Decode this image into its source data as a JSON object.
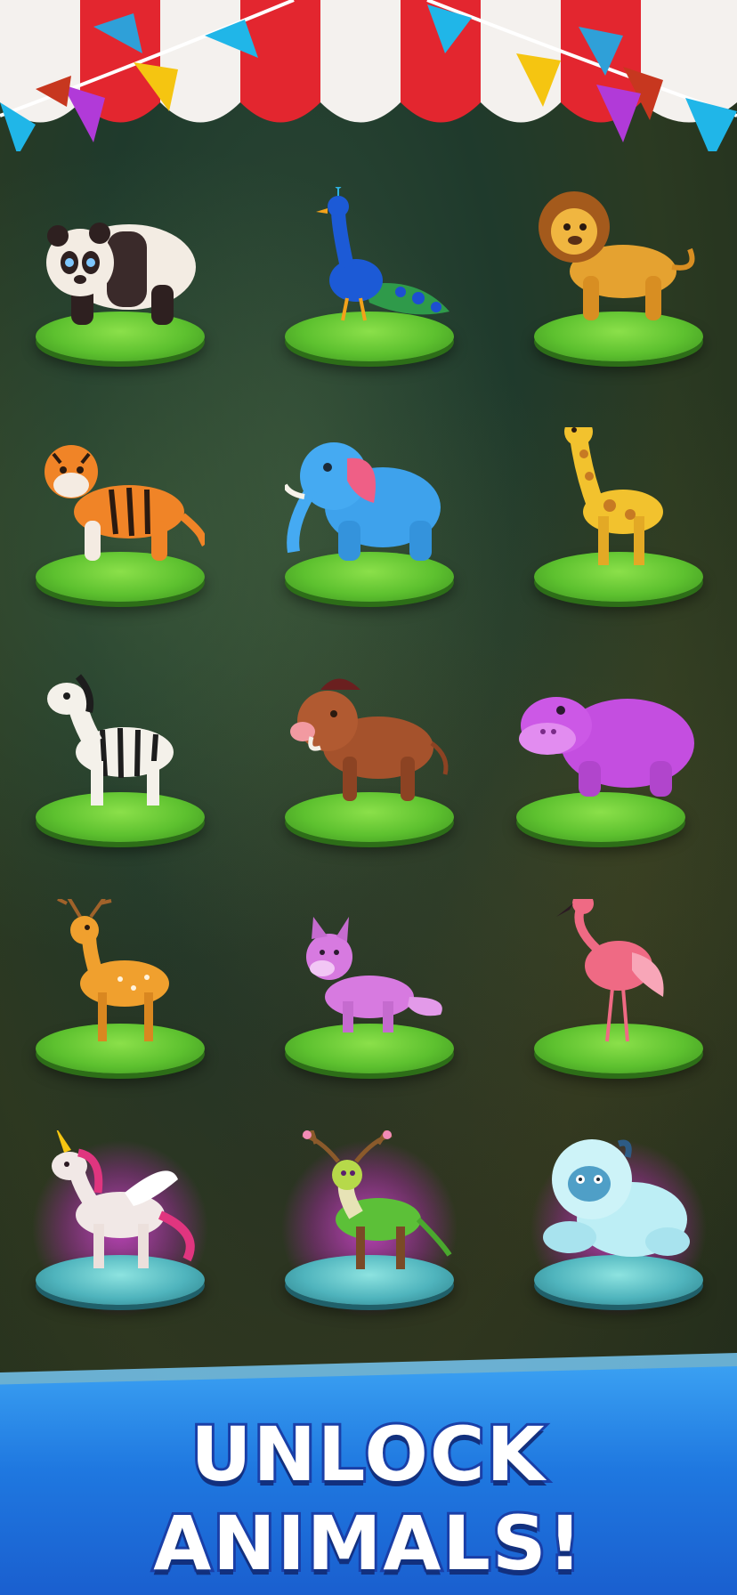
{
  "headline": {
    "line1": "UNLOCK",
    "line2": "ANIMALS!"
  },
  "colors": {
    "awning_red": "#e3262f",
    "awning_white": "#f4f1ee",
    "caption_blue": "#1f78e0",
    "grass_green": "#5dc12f",
    "mythic_glow": "#e046e0"
  },
  "animals": [
    {
      "name": "panda",
      "tier": "common"
    },
    {
      "name": "peacock",
      "tier": "common"
    },
    {
      "name": "lion",
      "tier": "common"
    },
    {
      "name": "tiger",
      "tier": "common"
    },
    {
      "name": "elephant",
      "tier": "common"
    },
    {
      "name": "giraffe",
      "tier": "common"
    },
    {
      "name": "zebra",
      "tier": "common"
    },
    {
      "name": "warthog",
      "tier": "common"
    },
    {
      "name": "hippo",
      "tier": "common"
    },
    {
      "name": "deer",
      "tier": "common"
    },
    {
      "name": "fox",
      "tier": "common"
    },
    {
      "name": "flamingo",
      "tier": "common"
    },
    {
      "name": "unicorn",
      "tier": "mythic"
    },
    {
      "name": "forest-stag",
      "tier": "mythic"
    },
    {
      "name": "yeti",
      "tier": "mythic"
    }
  ]
}
